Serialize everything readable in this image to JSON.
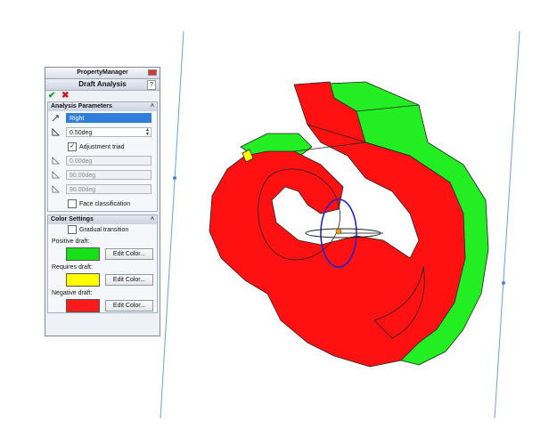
{
  "property_manager": {
    "title": "PropertyManager",
    "feature_title": "Draft Analysis",
    "help": "?",
    "analysis_parameters": {
      "header": "Analysis Parameters",
      "direction_value": "Right",
      "draft_angle": "0.50deg",
      "adjustment_triad_label": "Adjustment triad",
      "adjustment_triad_checked": true,
      "angle_x": "0.00deg",
      "angle_y": "90.00deg",
      "angle_z": "90.00deg",
      "face_classification_label": "Face classification",
      "face_classification_checked": false
    },
    "color_settings": {
      "header": "Color Settings",
      "gradual_transition_label": "Gradual transition",
      "gradual_transition_checked": false,
      "positive_label": "Positive draft:",
      "requires_label": "Requires draft:",
      "negative_label": "Negative draft:",
      "edit_color_label": "Edit Color...",
      "positive_color": "#18e018",
      "requires_color": "#ffff00",
      "negative_color": "#ff1a1a"
    }
  },
  "colors": {
    "model_positive": "#22ee22",
    "model_negative": "#ff1111",
    "triad_blue": "#2222cc"
  }
}
